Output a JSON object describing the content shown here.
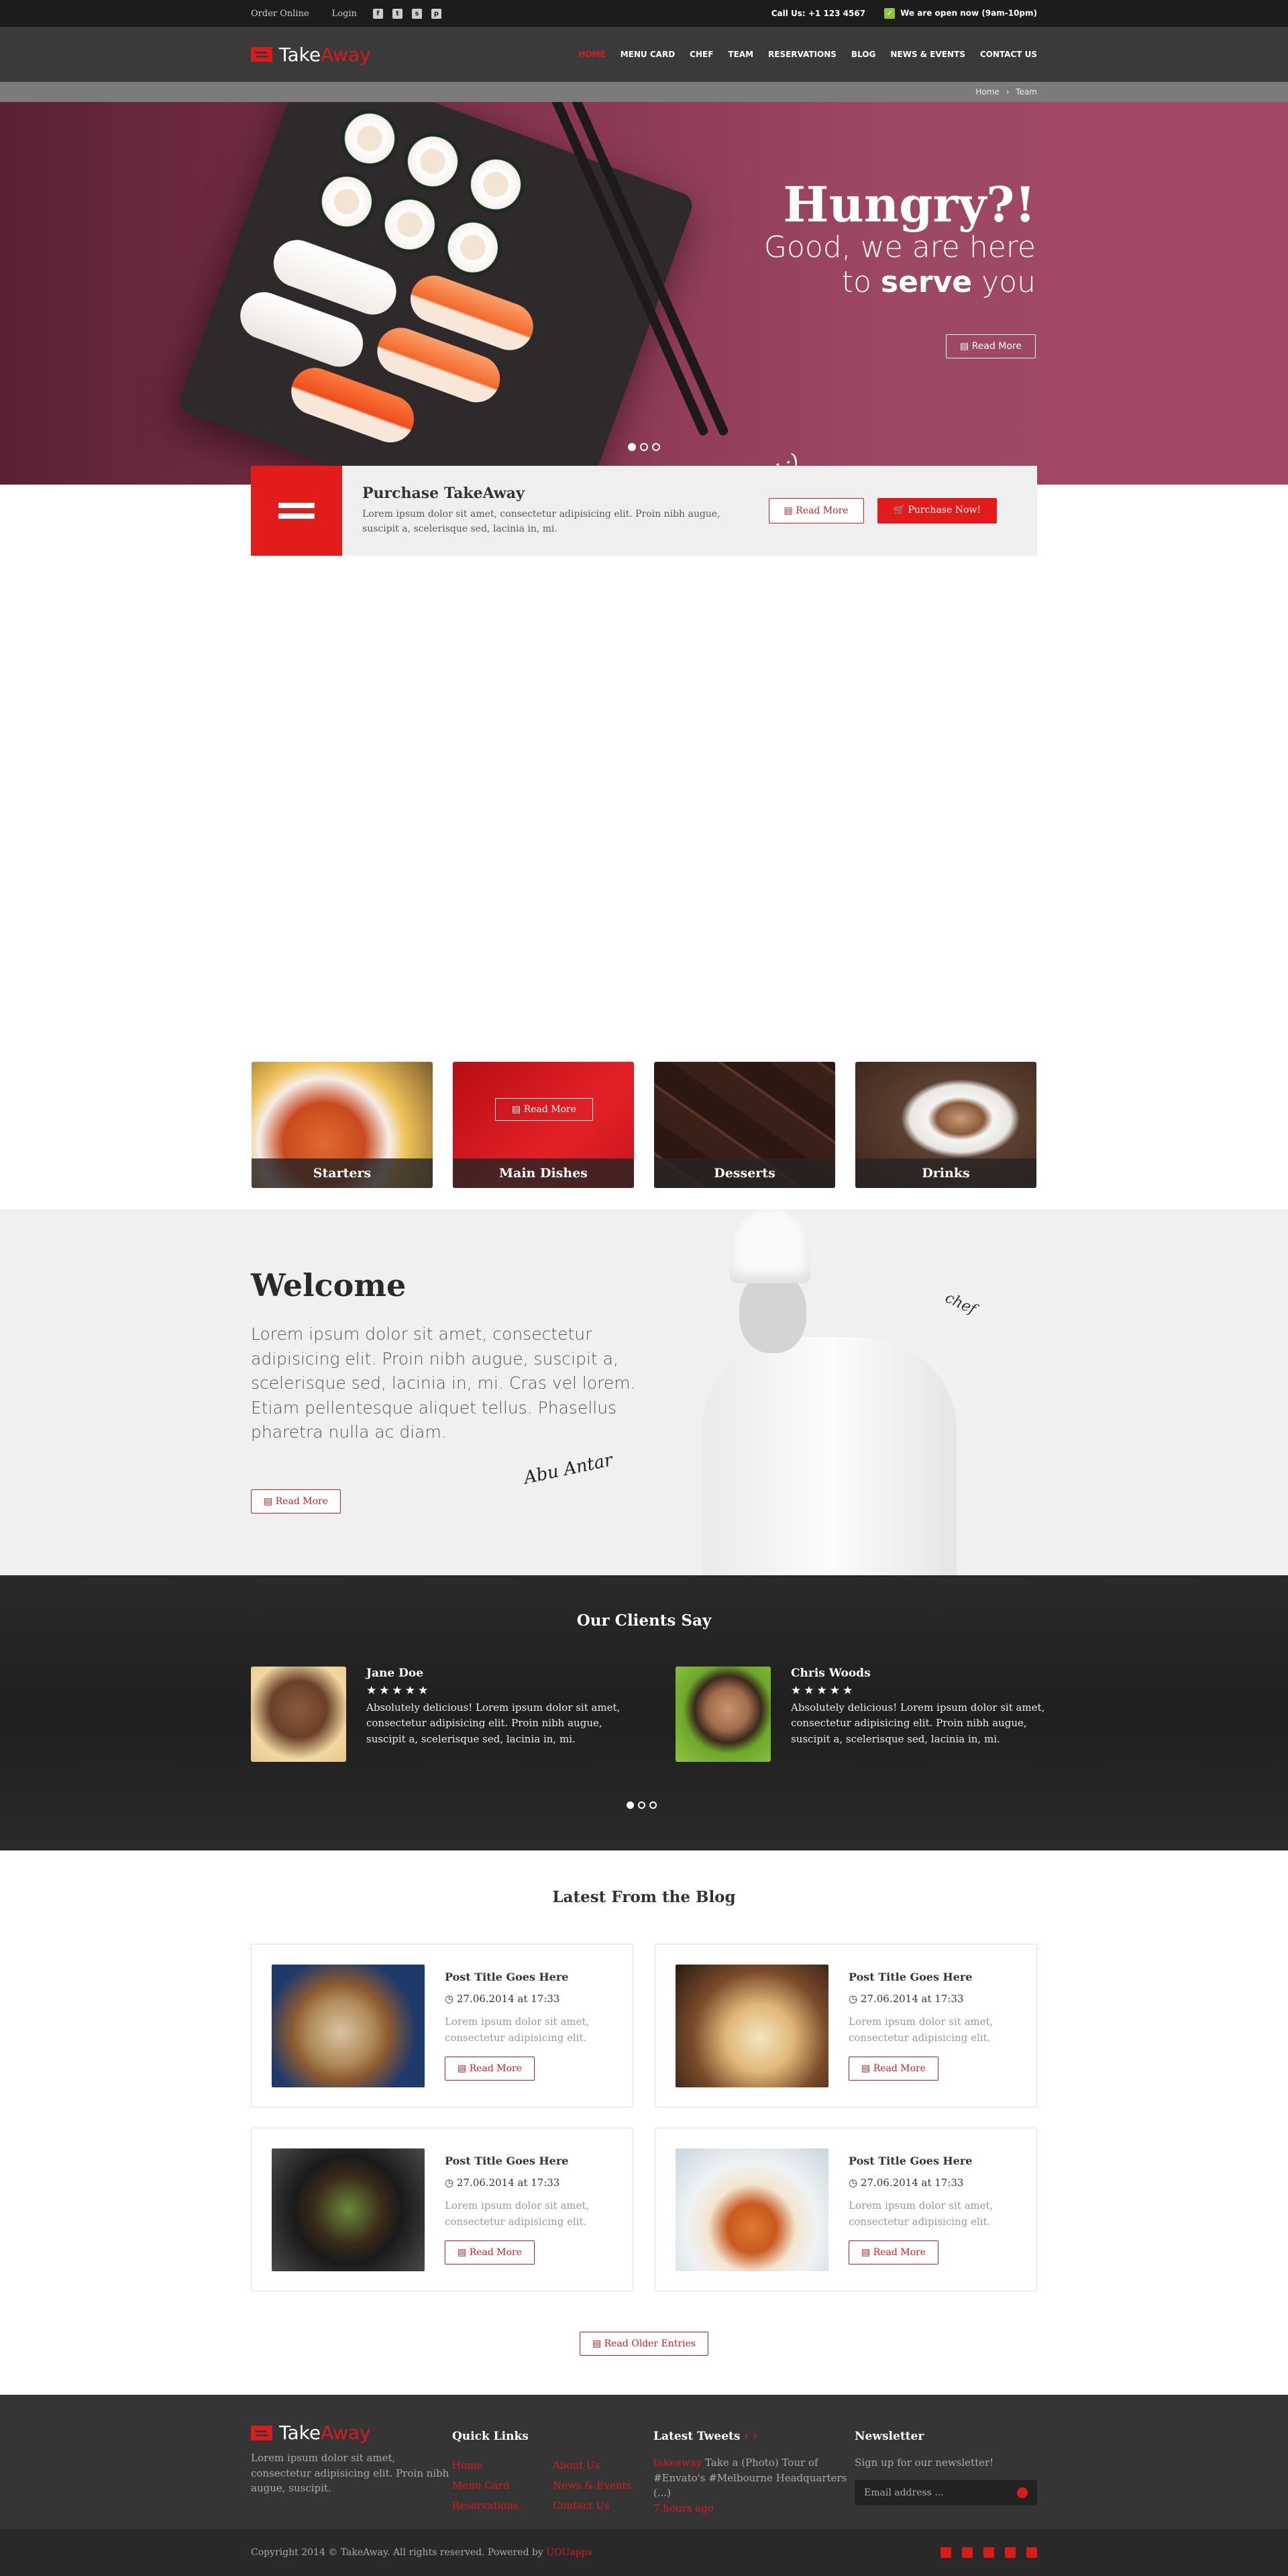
{
  "topbar": {
    "order_online": "Order Online",
    "login": "Login",
    "social_icons": [
      "facebook-icon",
      "twitter-icon",
      "skype-icon",
      "pinterest-icon"
    ],
    "call": "Call Us: +1 123 4567",
    "open": "We are open now (9am-10pm)"
  },
  "header": {
    "logo_a": "Take",
    "logo_b": "Away",
    "nav": [
      "HOME",
      "MENU CARD",
      "CHEF",
      "TEAM",
      "RESERVATIONS",
      "BLOG",
      "NEWS & EVENTS",
      "CONTACT US"
    ],
    "accent": "#d91b1b"
  },
  "breadcrumb": {
    "home": "Home",
    "sep": "›",
    "current": "Team"
  },
  "hero": {
    "title": "Hungry?!",
    "line1": "Good, we are here",
    "line2_a": "to ",
    "line2_b": "serve",
    "line2_c": " you",
    "button": "Read More",
    "handwriting": "yummy :)"
  },
  "purchase": {
    "title": "Purchase TakeAway",
    "text": "Lorem ipsum dolor sit amet, consectetur adipisicing elit. Proin nibh augue, suscipit a, scelerisque sed, lacinia in, mi.",
    "read_more": "Read More",
    "purchase_now": "Purchase Now!"
  },
  "categories": [
    {
      "label": "Starters"
    },
    {
      "label": "Main Dishes",
      "overlay": "Read More"
    },
    {
      "label": "Desserts"
    },
    {
      "label": "Drinks"
    }
  ],
  "welcome": {
    "title": "Welcome",
    "text": "Lorem ipsum dolor sit amet, consectetur adipisicing elit. Proin nibh augue, suscipit a, scelerisque sed, lacinia in, mi. Cras vel lorem. Etiam pellentesque aliquet tellus. Phasellus pharetra nulla ac diam.",
    "button": "Read More",
    "signature": "Abu Antar",
    "chef_note": "chef"
  },
  "clients": {
    "title": "Our Clients Say",
    "items": [
      {
        "name": "Jane Doe",
        "stars": "★★★★★",
        "text": "Absolutely delicious! Lorem ipsum dolor sit amet, consectetur adipisicing elit. Proin nibh augue, suscipit a, scelerisque sed, lacinia in, mi."
      },
      {
        "name": "Chris Woods",
        "stars": "★★★★★",
        "text": "Absolutely delicious! Lorem ipsum dolor sit amet, consectetur adipisicing elit. Proin nibh augue, suscipit a, scelerisque sed, lacinia in, mi."
      }
    ]
  },
  "blog": {
    "title": "Latest From the Blog",
    "posts": [
      {
        "title": "Post Title Goes Here",
        "date": "27.06.2014 at 17:33",
        "text": "Lorem ipsum dolor sit amet, consectetur adipisicing elit.",
        "button": "Read More"
      },
      {
        "title": "Post Title Goes Here",
        "date": "27.06.2014 at 17:33",
        "text": "Lorem ipsum dolor sit amet, consectetur adipisicing elit.",
        "button": "Read More"
      },
      {
        "title": "Post Title Goes Here",
        "date": "27.06.2014 at 17:33",
        "text": "Lorem ipsum dolor sit amet, consectetur adipisicing elit.",
        "button": "Read More"
      },
      {
        "title": "Post Title Goes Here",
        "date": "27.06.2014 at 17:33",
        "text": "Lorem ipsum dolor sit amet, consectetur adipisicing elit.",
        "button": "Read More"
      }
    ],
    "older": "Read Older Entries"
  },
  "footer": {
    "about": "Lorem ipsum dolor sit amet, consectetur adipisicing elit. Proin nibh augue, suscipit.",
    "quick_title": "Quick Links",
    "links": [
      "Home",
      "About Us",
      "Menu Card",
      "News & Events",
      "Reservations",
      "Contact Us"
    ],
    "tweets_title": "Latest Tweets",
    "tweet_handle": "takeaway",
    "tweet_text": "Take a (Photo) Tour of #Envato's #Melbourne Headquarters (...)",
    "tweet_time": "7 hours ago",
    "newsletter_title": "Newsletter",
    "newsletter_text": "Sign up for our newsletter!",
    "email_placeholder": "Email address ...",
    "copyright": "Copyright 2014 © TakeAway. All rights reserved. Powered by",
    "powered": "UOUapps"
  }
}
